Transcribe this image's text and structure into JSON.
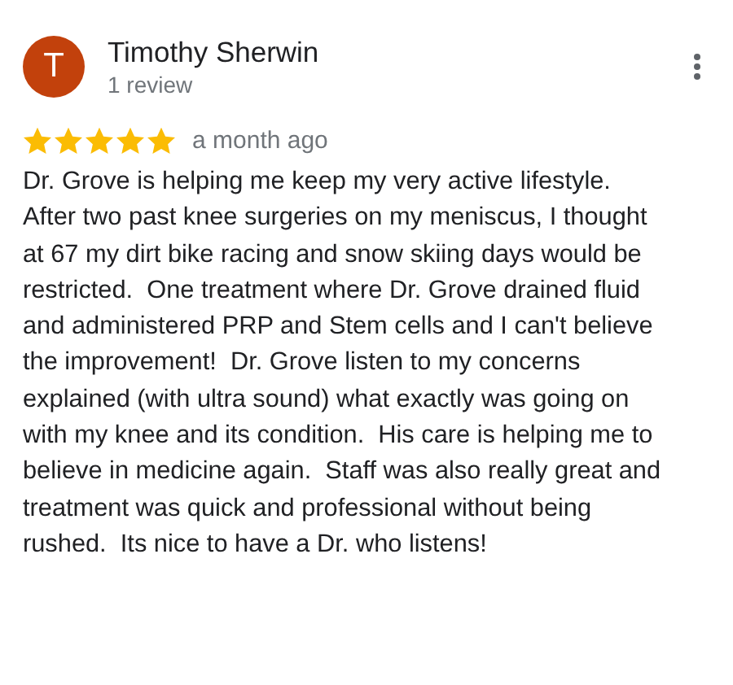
{
  "review": {
    "avatar_letter": "T",
    "author": "Timothy Sherwin",
    "author_meta": "1 review",
    "stars": 5,
    "time": "a month ago",
    "text": "Dr. Grove is helping me keep my very active lifestyle.  After two past knee surgeries on my meniscus, I thought at 67 my dirt bike racing and snow skiing days would be restricted.  One treatment where Dr. Grove drained fluid and administered PRP and Stem cells and I can't believe the improvement!  Dr. Grove listen to my concerns explained (with ultra sound) what exactly was going on with my knee and its condition.  His care is helping me to believe in medicine again.  Staff was also really great and treatment was quick and professional without being rushed.  Its nice to have a Dr. who listens!"
  }
}
